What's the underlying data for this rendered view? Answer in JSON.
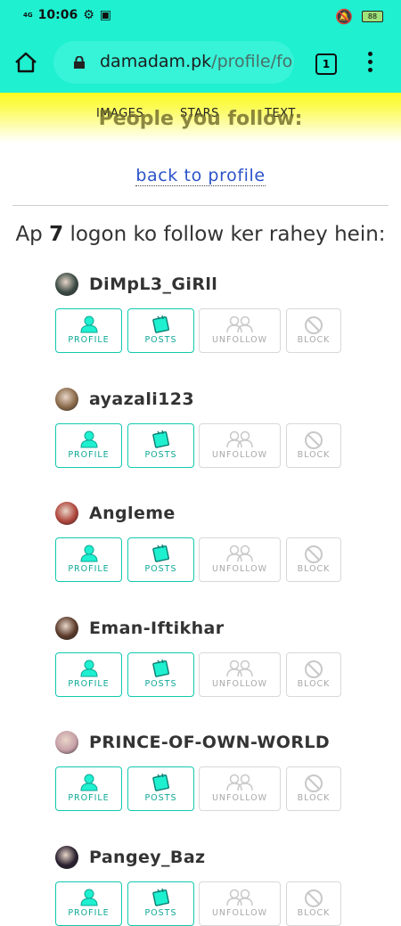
{
  "status_bar": {
    "network": "4G",
    "time": "10:06",
    "battery": "88"
  },
  "browser": {
    "url_host": "damadam.pk",
    "url_path": "/profile/fo",
    "tab_count": "1"
  },
  "nav": {
    "images": "IMAGES",
    "stars": "STARS",
    "text": "TEXT"
  },
  "page": {
    "title": "People you follow:",
    "back_link": "back to profile",
    "summary_prefix": "Ap",
    "summary_count": "7",
    "summary_suffix": "logon ko follow ker rahey hein:"
  },
  "buttons": {
    "profile": "PROFILE",
    "posts": "POSTS",
    "unfollow": "UNFOLLOW",
    "block": "BLOCK"
  },
  "users": [
    {
      "name": "DiMpL3_GiRll",
      "avatar_color": "#3a4a44"
    },
    {
      "name": "ayazali123",
      "avatar_color": "#8a6a4a"
    },
    {
      "name": "Angleme",
      "avatar_color": "#b0463c"
    },
    {
      "name": "Eman-Iftikhar",
      "avatar_color": "#5a3a2a"
    },
    {
      "name": "PRINCE-OF-OWN-WORLD",
      "avatar_color": "#c7a0a8"
    },
    {
      "name": "Pangey_Baz",
      "avatar_color": "#2a2030"
    }
  ],
  "colors": {
    "accent": "#1ef0d0",
    "button_border": "#12c9b0",
    "link": "#2b53c9"
  }
}
